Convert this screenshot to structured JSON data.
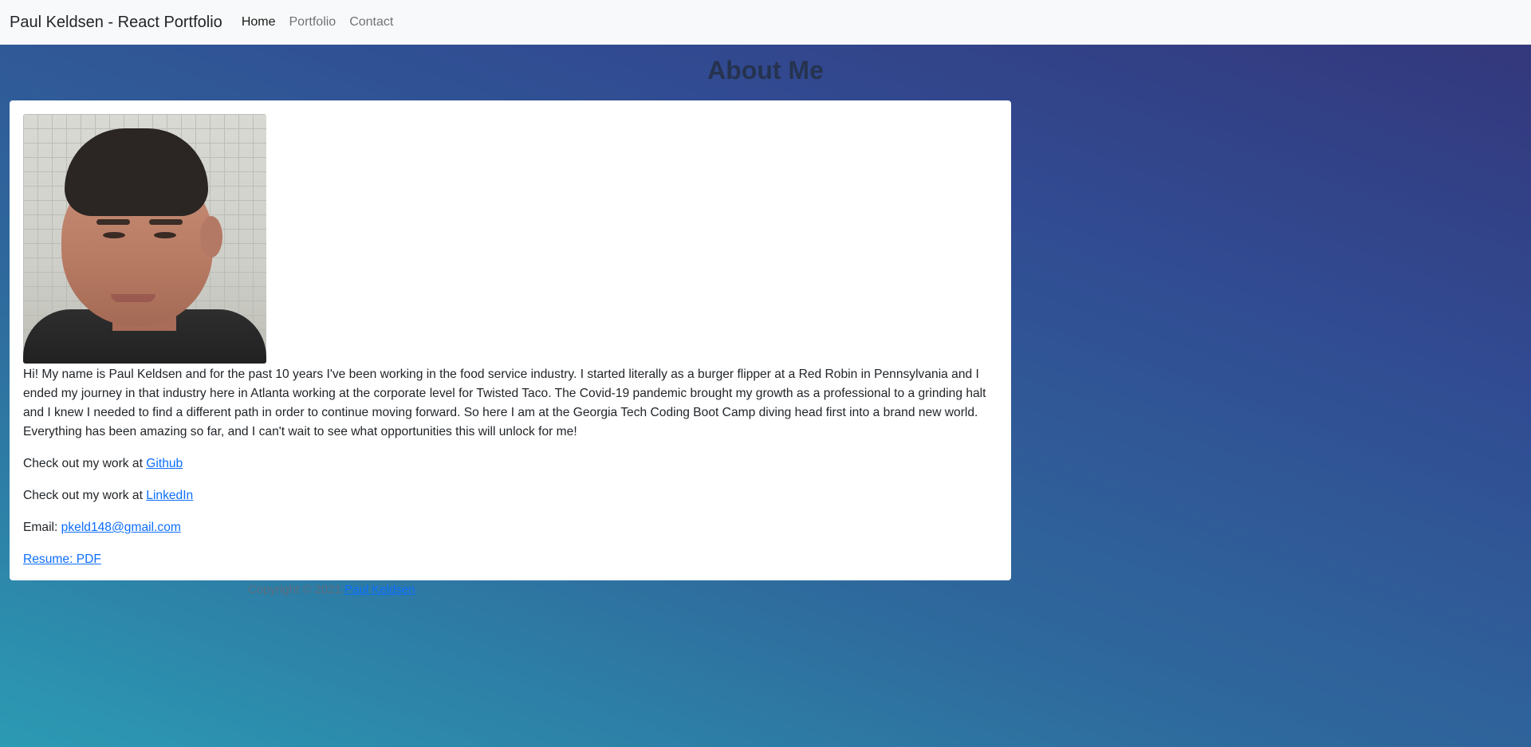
{
  "navbar": {
    "brand": "Paul Keldsen - React Portfolio",
    "links": [
      {
        "label": "Home",
        "active": true
      },
      {
        "label": "Portfolio",
        "active": false
      },
      {
        "label": "Contact",
        "active": false
      }
    ]
  },
  "page": {
    "title": "About Me"
  },
  "about": {
    "bio": "Hi! My name is Paul Keldsen and for the past 10 years I've been working in the food service industry. I started literally as a burger flipper at a Red Robin in Pennsylvania and I ended my journey in that industry here in Atlanta working at the corporate level for Twisted Taco. The Covid-19 pandemic brought my growth as a professional to a grinding halt and I knew I needed to find a different path in order to continue moving forward. So here I am at the Georgia Tech Coding Boot Camp diving head first into a brand new world. Everything has been amazing so far, and I can't wait to see what opportunities this will unlock for me!",
    "github_prefix": "Check out my work at ",
    "github_label": "Github",
    "linkedin_prefix": "Check out my work at ",
    "linkedin_label": "LinkedIn",
    "email_prefix": "Email: ",
    "email": "pkeld148@gmail.com",
    "resume_label": "Resume: PDF"
  },
  "footer": {
    "copyright": "Copyright © 2021",
    "author_link": "Paul Keldsen"
  },
  "colors": {
    "link": "#0d6efd",
    "navbar_bg": "#f8f9fa"
  }
}
